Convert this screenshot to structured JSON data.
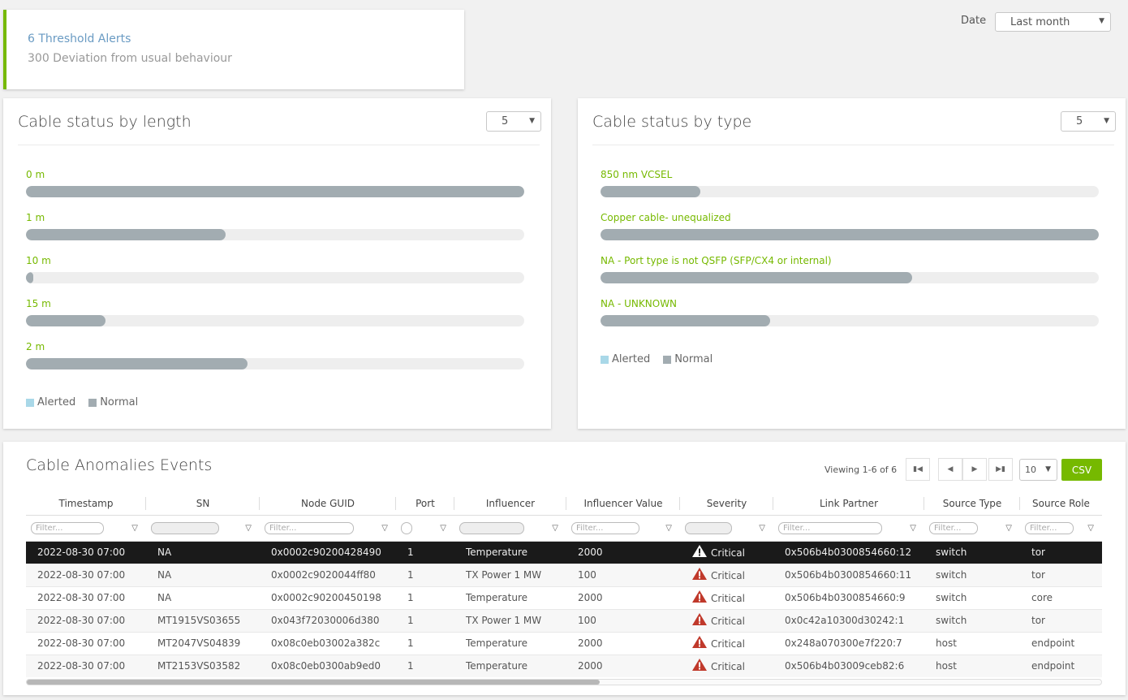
{
  "alerts": {
    "threshold_text": "6 Threshold Alerts",
    "deviation_text": "300 Deviation from usual behaviour",
    "accent_color": "#76b900"
  },
  "date_filter": {
    "label": "Date",
    "value": "Last month"
  },
  "length_card": {
    "title": "Cable status by length",
    "top_n": "5",
    "bars": [
      {
        "label": "0 m",
        "normal_fraction": 1.0,
        "alerted_fraction": 0.0
      },
      {
        "label": "1 m",
        "normal_fraction": 0.4,
        "alerted_fraction": 0.0
      },
      {
        "label": "10 m",
        "normal_fraction": 0.015,
        "alerted_fraction": 0.0
      },
      {
        "label": "15 m",
        "normal_fraction": 0.16,
        "alerted_fraction": 0.0
      },
      {
        "label": "2 m",
        "normal_fraction": 0.445,
        "alerted_fraction": 0.0
      }
    ],
    "legend": {
      "alerted": "Alerted",
      "normal": "Normal"
    }
  },
  "type_card": {
    "title": "Cable status by type",
    "top_n": "5",
    "bars": [
      {
        "label": "850 nm VCSEL",
        "normal_fraction": 0.2,
        "alerted_fraction": 0.0
      },
      {
        "label": "Copper cable- unequalized",
        "normal_fraction": 1.0,
        "alerted_fraction": 0.0
      },
      {
        "label": "NA - Port type is not QSFP (SFP/CX4 or internal)",
        "normal_fraction": 0.625,
        "alerted_fraction": 0.0
      },
      {
        "label": "NA - UNKNOWN",
        "normal_fraction": 0.34,
        "alerted_fraction": 0.0
      }
    ],
    "legend": {
      "alerted": "Alerted",
      "normal": "Normal"
    }
  },
  "colors": {
    "alerted": "#a9d8e8",
    "normal": "#a2acb1",
    "label_green": "#76b900",
    "critical": "#c0392b"
  },
  "events": {
    "title": "Cable Anomalies Events",
    "viewing": "Viewing 1-6 of 6",
    "page_size": "10",
    "csv_label": "CSV",
    "filter_placeholder": "Filter...",
    "columns": [
      "Timestamp",
      "SN",
      "Node GUID",
      "Port",
      "Influencer",
      "Influencer Value",
      "Severity",
      "Link Partner",
      "Source Type",
      "Source Role"
    ],
    "rows": [
      [
        "2022-08-30 07:00",
        "NA",
        "0x0002c90200428490",
        "1",
        "Temperature",
        "2000",
        "Critical",
        "0x506b4b0300854660:12",
        "switch",
        "tor"
      ],
      [
        "2022-08-30 07:00",
        "NA",
        "0x0002c9020044ff80",
        "1",
        "TX Power 1 MW",
        "100",
        "Critical",
        "0x506b4b0300854660:11",
        "switch",
        "tor"
      ],
      [
        "2022-08-30 07:00",
        "NA",
        "0x0002c90200450198",
        "1",
        "Temperature",
        "2000",
        "Critical",
        "0x506b4b0300854660:9",
        "switch",
        "core"
      ],
      [
        "2022-08-30 07:00",
        "MT1915VS03655",
        "0x043f72030006d380",
        "1",
        "TX Power 1 MW",
        "100",
        "Critical",
        "0x0c42a10300d30242:1",
        "switch",
        "tor"
      ],
      [
        "2022-08-30 07:00",
        "MT2047VS04839",
        "0x08c0eb03002a382c",
        "1",
        "Temperature",
        "2000",
        "Critical",
        "0x248a070300e7f220:7",
        "host",
        "endpoint"
      ],
      [
        "2022-08-30 07:00",
        "MT2153VS03582",
        "0x08c0eb0300ab9ed0",
        "1",
        "Temperature",
        "2000",
        "Critical",
        "0x506b4b03009ceb82:6",
        "host",
        "endpoint"
      ]
    ],
    "selected_row": 0
  }
}
